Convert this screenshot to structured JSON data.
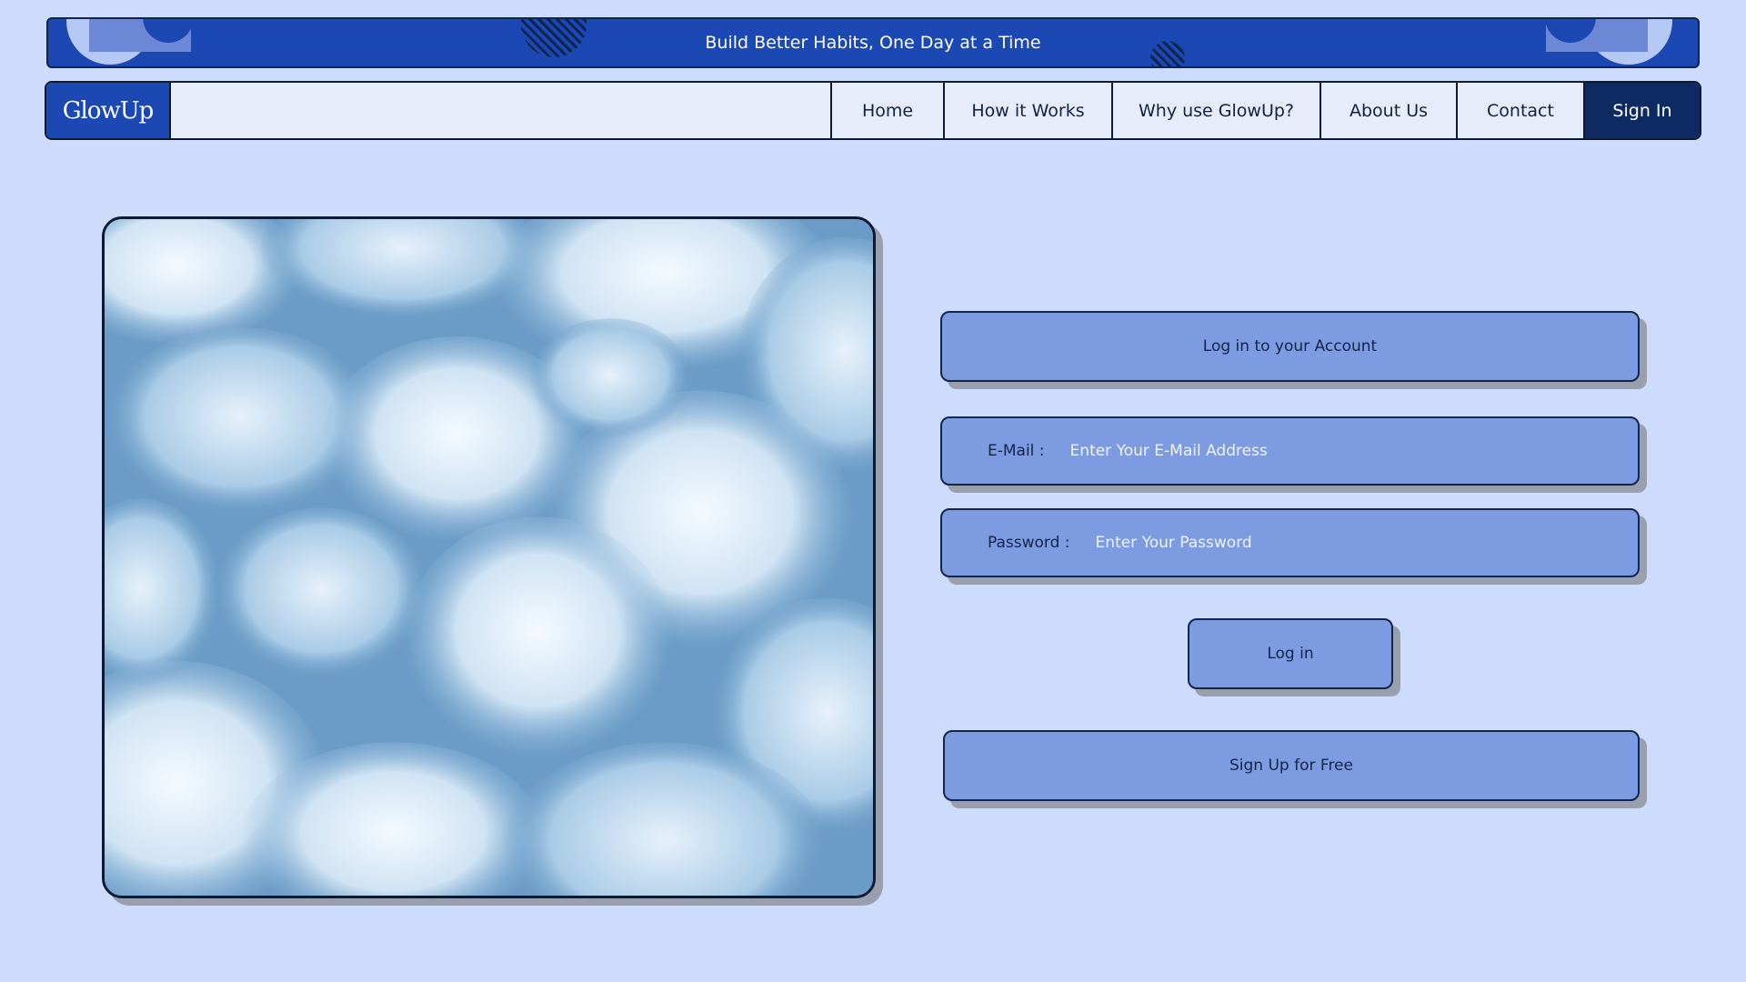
{
  "banner": {
    "text": "Build Better Habits, One Day at a Time"
  },
  "nav": {
    "logo": "GlowUp",
    "items": [
      "Home",
      "How it Works",
      "Why use GlowUp?",
      "About Us",
      "Contact"
    ],
    "sign_in": "Sign In"
  },
  "hero": {
    "image": "clouds-image"
  },
  "login": {
    "title": "Log in to your Account",
    "email_label": "E-Mail  :",
    "email_placeholder": "Enter Your E-Mail Address",
    "password_label": "Password  :",
    "password_placeholder": "Enter Your Password",
    "login_button": "Log in",
    "signup_button": "Sign Up for Free"
  },
  "colors": {
    "page_bg": "#cddbfd",
    "brand_blue": "#1b48b3",
    "form_box": "#7d9be0",
    "sign_in_bg": "#0e2a63"
  }
}
